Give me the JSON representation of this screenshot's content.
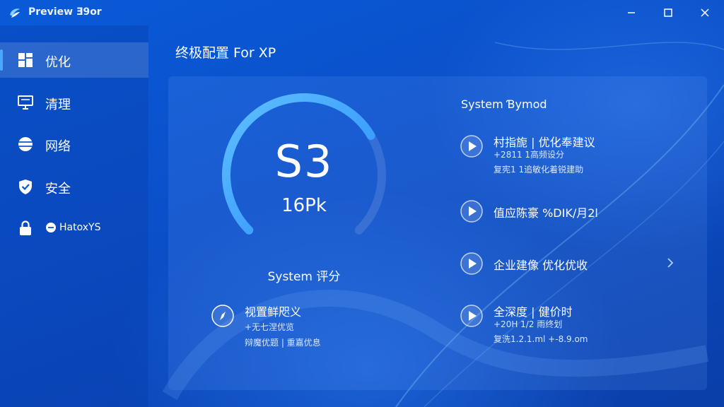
{
  "window": {
    "title": "Preview Ǝ9or"
  },
  "sidebar": {
    "items": [
      {
        "label": "优化",
        "icon": "grid-icon",
        "active": true
      },
      {
        "label": "清理",
        "icon": "monitor-icon",
        "active": false
      },
      {
        "label": "网络",
        "icon": "network-icon",
        "active": false
      },
      {
        "label": "安全",
        "icon": "shield-icon",
        "active": false
      },
      {
        "label": "HatoxYS",
        "icon": "lock-icon",
        "active": false
      }
    ]
  },
  "main": {
    "title": "终极配置 For XP",
    "score": {
      "value": "S3",
      "sub": "16Pk",
      "label": "System 评分",
      "gauge_fraction": 0.72
    },
    "section_title": "System Ɓymod",
    "left_rec": {
      "title": "视置鲜咫义",
      "line1": "+无七涅优览",
      "line2": "辩魔优题 | 重嘉优息"
    },
    "right_recs": [
      {
        "title": "村指旎 | 优化奉建议",
        "line1": "+2811 1高频设分",
        "line2": "复宪1 1追敏化着锐建助"
      },
      {
        "title": "值应陈豪 %DIK/月2l",
        "line1": "",
        "line2": ""
      },
      {
        "title": "企业建像 优化优收",
        "line1": "",
        "line2": ""
      },
      {
        "title": "全深度 | 健价时",
        "line1": "+20H 1/2 雨终划",
        "line2": "复洗1.2.1.ml +-8.9.om"
      }
    ]
  },
  "colors": {
    "accent": "#3aa0ff",
    "background": "#0b4fc8"
  }
}
